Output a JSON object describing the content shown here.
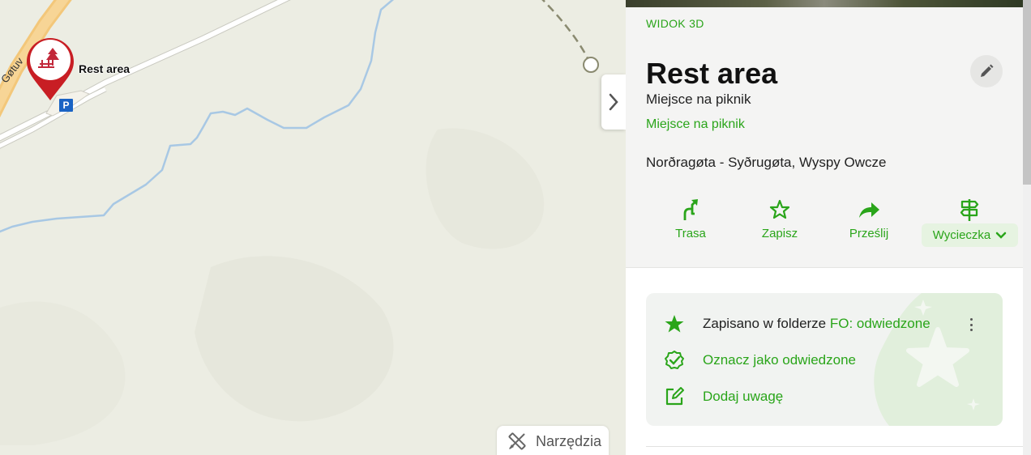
{
  "map": {
    "road_name": "Gøtuv",
    "poi_label": "Rest area",
    "parking_glyph": "P",
    "pin_icon": "picnic-table-icon",
    "collapse_icon": "chevron-right-icon",
    "tools_label": "Narzędzia"
  },
  "panel": {
    "view_3d": "WIDOK 3D",
    "title": "Rest area",
    "subtitle": "Miejsce na piknik",
    "category": "Miejsce na piknik",
    "address": "Norðragøta - Syðrugøta, Wyspy Owcze",
    "actions": [
      {
        "label": "Trasa",
        "icon": "route-icon"
      },
      {
        "label": "Zapisz",
        "icon": "star-icon"
      },
      {
        "label": "Prześlij",
        "icon": "share-icon"
      },
      {
        "label": "Wycieczka",
        "icon": "signpost-icon"
      }
    ],
    "saved": {
      "text": "Zapisano w folderze",
      "folder": "FO: odwiedzone",
      "mark_visited": "Oznacz jako odwiedzone",
      "add_note": "Dodaj uwagę"
    }
  },
  "colors": {
    "accent_green": "#2aa51a",
    "pin_red": "#c81e24",
    "river_blue": "#a8c8e4",
    "parking_blue": "#1a63c4"
  }
}
